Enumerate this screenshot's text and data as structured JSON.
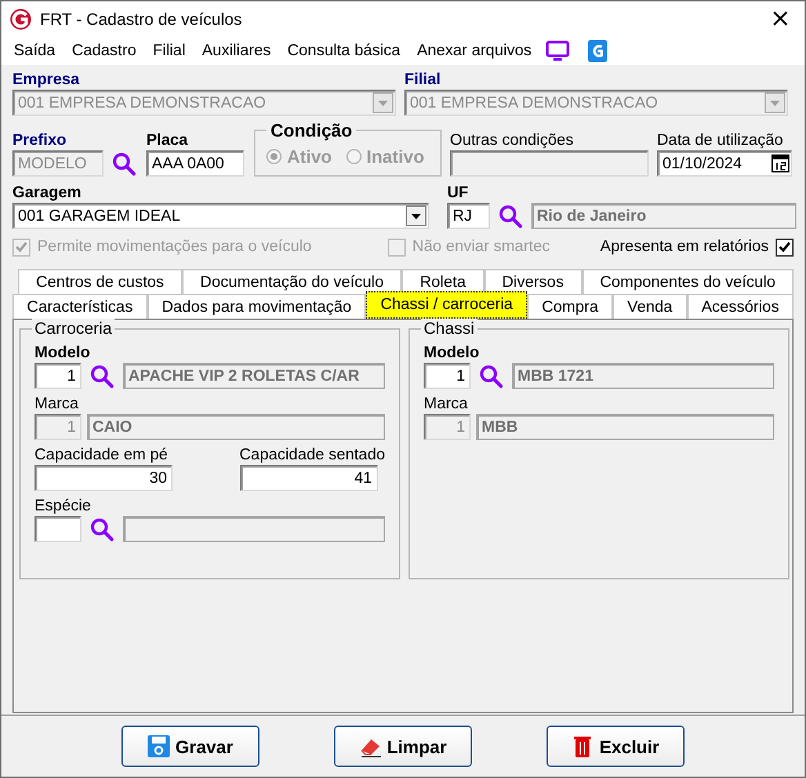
{
  "window": {
    "title": "FRT - Cadastro de veículos",
    "close": "×"
  },
  "menu": [
    {
      "label": "Saída"
    },
    {
      "label": "Cadastro"
    },
    {
      "label": "Filial"
    },
    {
      "label": "Auxiliares"
    },
    {
      "label": "Consulta básica"
    },
    {
      "label": "Anexar arquivos"
    }
  ],
  "empresa": {
    "label": "Empresa",
    "label_bold": true,
    "key_field": true,
    "value": "001 EMPRESA DEMONSTRACAO",
    "disabled": true
  },
  "filial": {
    "label": "Filial",
    "label_bold": true,
    "key_field": true,
    "value": "001 EMPRESA DEMONSTRACAO",
    "disabled": true
  },
  "prefixo": {
    "label": "Prefixo",
    "label_bold": true,
    "key_field": true,
    "value": "MODELO",
    "disabled": true
  },
  "placa": {
    "label": "Placa",
    "label_bold": true,
    "key_field": false,
    "value": "AAA 0A00",
    "disabled": false
  },
  "condicao": {
    "label": "Condição",
    "disabled": true,
    "options": [
      {
        "label": "Ativo",
        "selected": true
      },
      {
        "label": "Inativo",
        "selected": false
      }
    ]
  },
  "outras_condicoes": {
    "label": "Outras condições",
    "label_bold": false,
    "key_field": false,
    "disabled": true
  },
  "data_utilizacao": {
    "label": "Data de utilização",
    "label_bold": false,
    "key_field": false,
    "value": "01/10/2024",
    "disabled": false
  },
  "garagem": {
    "label": "Garagem",
    "label_bold": true,
    "key_field": false,
    "value": "001 GARAGEM IDEAL",
    "disabled": false
  },
  "uf": {
    "label": "UF",
    "label_bold": true,
    "key_field": false,
    "code": "RJ",
    "name": "Rio de Janeiro"
  },
  "checkboxes": [
    {
      "label": "Permite movimentações para o veículo",
      "checked": true,
      "disabled": true
    },
    {
      "label": "Não enviar smartec",
      "checked": false,
      "disabled": true
    },
    {
      "label": "Apresenta em relatórios",
      "checked": true,
      "disabled": false
    }
  ],
  "tab_rows": [
    {
      "tabs": [
        {
          "label": "Centros de custos",
          "selected": false
        },
        {
          "label": "Documentação do veículo",
          "selected": false
        },
        {
          "label": "Roleta",
          "selected": false
        },
        {
          "label": "Diversos",
          "selected": false
        },
        {
          "label": "Componentes do veículo",
          "selected": false
        }
      ]
    },
    {
      "tabs": [
        {
          "label": "Características",
          "selected": false
        },
        {
          "label": "Dados para movimentação",
          "selected": false
        },
        {
          "label": "Chassi / carroceria",
          "selected": true
        },
        {
          "label": "Compra",
          "selected": false
        },
        {
          "label": "Venda",
          "selected": false
        },
        {
          "label": "Acessórios",
          "selected": false
        }
      ]
    }
  ],
  "carroceria": {
    "title": "Carroceria",
    "modelo": {
      "label": "Modelo",
      "label_bold": true,
      "key_field": false,
      "code": "1",
      "name": "APACHE VIP 2 ROLETAS C/AR",
      "editable": true
    },
    "marca": {
      "label": "Marca",
      "label_bold": false,
      "key_field": false,
      "code": "1",
      "name": "CAIO",
      "editable": false
    },
    "capacidades": [
      {
        "label": "Capacidade em pé",
        "value": "30"
      },
      {
        "label": "Capacidade sentado",
        "value": "41"
      }
    ],
    "especie": {
      "label": "Espécie",
      "label_bold": false,
      "key_field": false,
      "editable": true
    }
  },
  "chassi": {
    "title": "Chassi",
    "modelo": {
      "label": "Modelo",
      "label_bold": true,
      "key_field": false,
      "code": "1",
      "name": "MBB 1721",
      "editable": true
    },
    "marca": {
      "label": "Marca",
      "label_bold": false,
      "key_field": false,
      "code": "1",
      "name": "MBB",
      "editable": false
    }
  },
  "buttons": [
    {
      "label": "Gravar",
      "kind": "save"
    },
    {
      "label": "Limpar",
      "kind": "clear"
    },
    {
      "label": "Excluir",
      "kind": "delete"
    }
  ]
}
